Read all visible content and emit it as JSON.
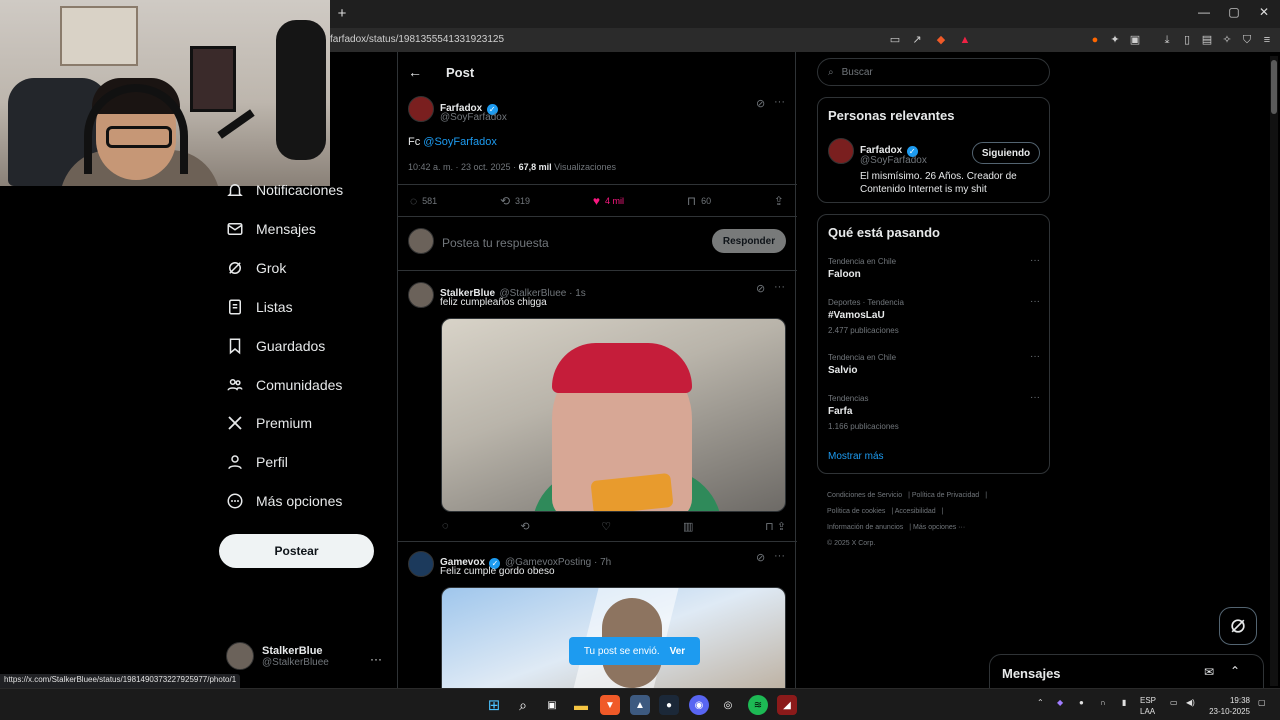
{
  "browser": {
    "url": "farfadox/status/1981355541331923125",
    "new_tab": "+",
    "status_url": "https://x.com/StalkerBluee/status/1981490373227925977/photo/1"
  },
  "nav": {
    "items": [
      {
        "label": "Notificaciones",
        "icon": "bell-icon"
      },
      {
        "label": "Mensajes",
        "icon": "mail-icon"
      },
      {
        "label": "Grok",
        "icon": "grok-icon"
      },
      {
        "label": "Listas",
        "icon": "list-icon"
      },
      {
        "label": "Guardados",
        "icon": "bookmark-icon"
      },
      {
        "label": "Comunidades",
        "icon": "communities-icon"
      },
      {
        "label": "Premium",
        "icon": "x-logo-icon"
      },
      {
        "label": "Perfil",
        "icon": "profile-icon"
      },
      {
        "label": "Más opciones",
        "icon": "more-circle-icon"
      }
    ],
    "post_button": "Postear",
    "account": {
      "name": "StalkerBlue",
      "handle": "@StalkerBluee",
      "more": "···"
    }
  },
  "main": {
    "title": "Post",
    "post": {
      "name": "Farfadox",
      "handle": "@SoyFarfadox",
      "text_prefix": "Fc",
      "mention": "@SoyFarfadox",
      "time": "10:42 a. m. · 23 oct. 2025 ·",
      "views_count": "67,8 mil",
      "views_label": "Visualizaciones",
      "replies": "581",
      "reposts": "319",
      "likes": "4 mil",
      "bookmarks": "60"
    },
    "reply_box": {
      "placeholder": "Postea tu respuesta",
      "button": "Responder"
    },
    "replies": [
      {
        "name": "StalkerBlue",
        "handle": "@StalkerBluee · 1s",
        "text": "feliz cumpleaños chigga"
      },
      {
        "name": "Gamevox",
        "handle": "@GamevoxPosting · 7h",
        "text": "Feliz cumple gordo obeso"
      }
    ],
    "toast": {
      "text": "Tu post se envió.",
      "action": "Ver"
    }
  },
  "right": {
    "search_placeholder": "Buscar",
    "relevant": {
      "title": "Personas relevantes",
      "name": "Farfadox",
      "handle": "@SoyFarfadox",
      "button": "Siguiendo",
      "bio": "El mismísimo. 26 Años. Creador de Contenido Internet is my shit"
    },
    "trends": {
      "title": "Qué está pasando",
      "items": [
        {
          "meta": "Tendencia en Chile",
          "name": "Faloon",
          "count": ""
        },
        {
          "meta": "Deportes · Tendencia",
          "name": "#VamosLaU",
          "count": "2.477 publicaciones"
        },
        {
          "meta": "Tendencia en Chile",
          "name": "Salvio",
          "count": ""
        },
        {
          "meta": "Tendencias",
          "name": "Farfa",
          "count": "1.166 publicaciones"
        }
      ],
      "show_more": "Mostrar más"
    },
    "footer": {
      "terms": "Condiciones de Servicio",
      "privacy": "Política de Privacidad",
      "cookies": "Política de cookies",
      "accessibility": "Accesibilidad",
      "ads": "Información de anuncios",
      "more": "Más opciones ···",
      "copyright": "© 2025 X Corp."
    },
    "messages_drawer": "Mensajes"
  },
  "taskbar": {
    "lang": "ESP",
    "layout": "LAA",
    "time": "19:38",
    "date": "23-10-2025"
  },
  "colors": {
    "accent": "#1d9bf0",
    "like": "#f91880",
    "background": "#000000",
    "border": "#2f3336"
  }
}
